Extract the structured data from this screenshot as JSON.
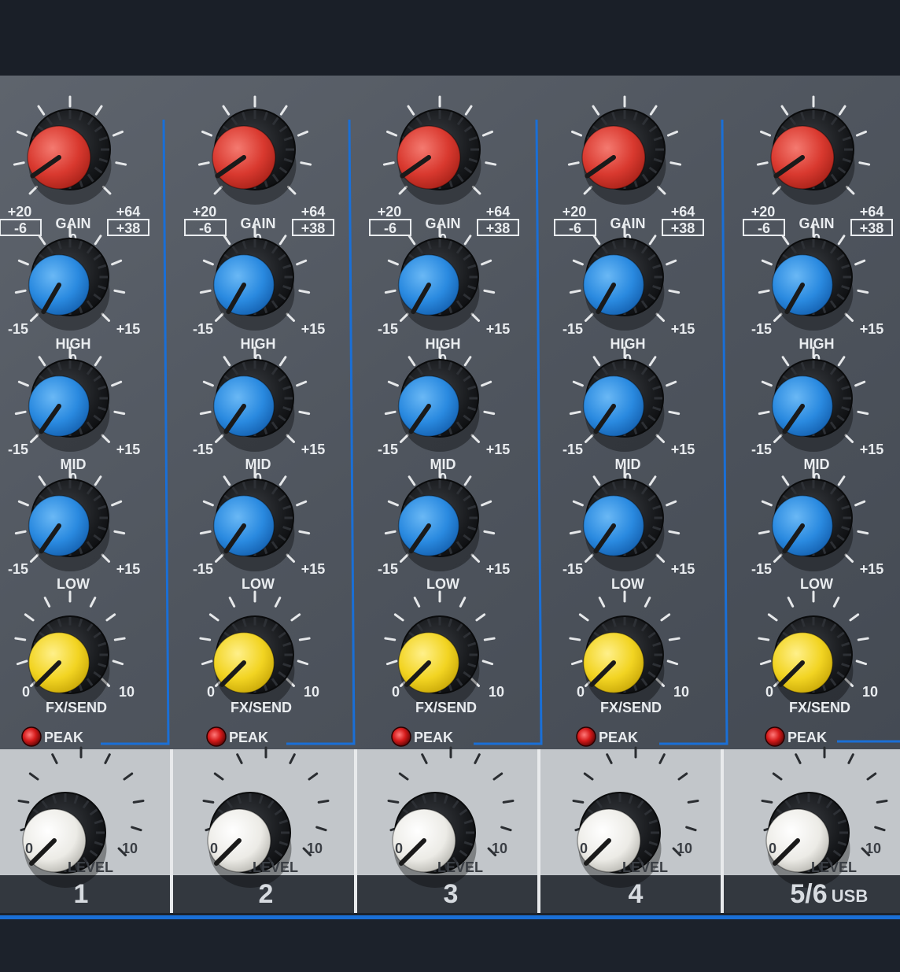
{
  "labels": {
    "gain": "GAIN",
    "gain_min": "+20",
    "gain_max": "+64",
    "gain_min_alt": "-6",
    "gain_max_alt": "+38",
    "zero": "0",
    "eq_min": "-15",
    "eq_max": "+15",
    "high": "HIGH",
    "mid": "MID",
    "low": "LOW",
    "fx_send": "FX/SEND",
    "fx_min": "0",
    "fx_max": "10",
    "peak": "PEAK",
    "level": "LEVEL",
    "level_min": "0",
    "level_max": "10"
  },
  "channels": [
    {
      "number": "1"
    },
    {
      "number": "2"
    },
    {
      "number": "3"
    },
    {
      "number": "4"
    },
    {
      "number": "5/6",
      "suffix": "USB"
    }
  ],
  "colors": {
    "panel": "#5b616a",
    "panel_dark": "#3b4048",
    "accent_blue": "#1a6fd6",
    "gain_cap": "#e0413b",
    "eq_cap": "#2f8fe0",
    "fx_cap": "#f2d422",
    "level_cap": "#f2f2f0",
    "peak_led": "#d41a1a",
    "level_strip": "#bfc3c7"
  }
}
